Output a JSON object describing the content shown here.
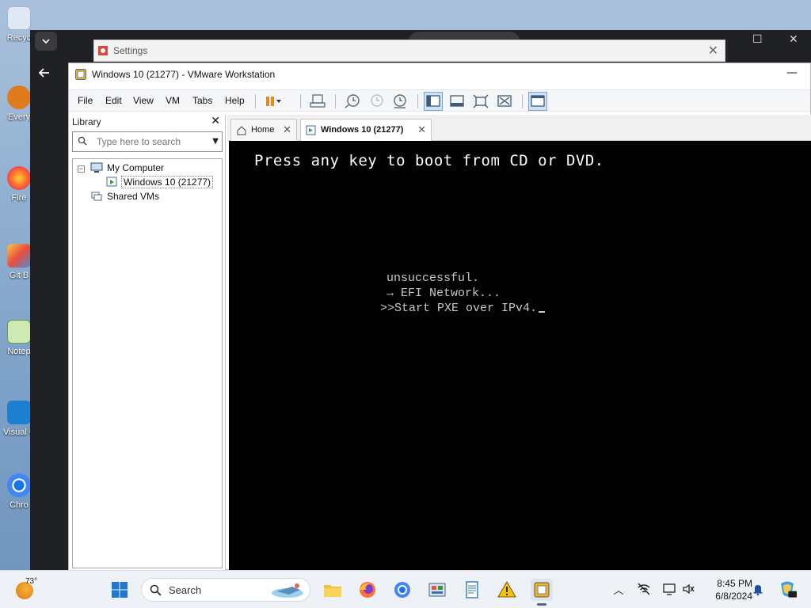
{
  "desktop": {
    "icons": [
      {
        "label": "Recyc",
        "icon": "recycle-bin-icon"
      },
      {
        "label": "Every",
        "icon": "everything-icon"
      },
      {
        "label": "Fire",
        "icon": "firefox-icon"
      },
      {
        "label": "Git B",
        "icon": "git-icon"
      },
      {
        "label": "Notep",
        "icon": "notepad-icon"
      },
      {
        "label": "Visual Co",
        "icon": "vscode-icon"
      },
      {
        "label": "Chro",
        "icon": "chrome-icon"
      }
    ]
  },
  "settings": {
    "title": "Settings"
  },
  "vmware": {
    "title": "Windows 10 (21277) - VMware Workstation",
    "menu": [
      "File",
      "Edit",
      "View",
      "VM",
      "Tabs",
      "Help"
    ],
    "library": {
      "header": "Library",
      "search_placeholder": "Type here to search",
      "tree": {
        "root": "My Computer",
        "vm": "Windows 10 (21277)",
        "shared": "Shared VMs"
      }
    },
    "tabs": [
      {
        "label": "Home"
      },
      {
        "label": "Windows 10 (21277)"
      }
    ],
    "console": {
      "boot_message": "Press any key to boot from CD or DVD.",
      "efi_lines": [
        "unsuccessful.",
        "→ EFI Network...",
        ">>Start PXE over IPv4."
      ]
    }
  },
  "taskbar": {
    "weather": "73°",
    "search_label": "Search",
    "clock": {
      "time": "8:45 PM",
      "date": "6/8/2024"
    }
  }
}
